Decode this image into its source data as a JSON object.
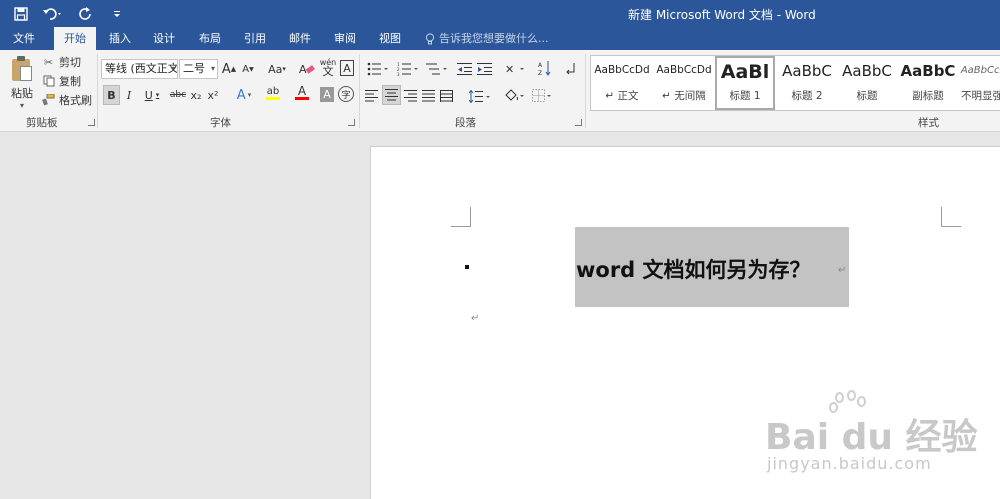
{
  "window": {
    "title": "新建 Microsoft Word 文档 - Word"
  },
  "quick_access": {
    "save_icon": "save-icon",
    "undo_icon": "undo-icon",
    "redo_icon": "redo-icon",
    "customize_icon": "customize-qat-icon"
  },
  "tabs": [
    {
      "label": "文件"
    },
    {
      "label": "开始"
    },
    {
      "label": "插入"
    },
    {
      "label": "设计"
    },
    {
      "label": "布局"
    },
    {
      "label": "引用"
    },
    {
      "label": "邮件"
    },
    {
      "label": "审阅"
    },
    {
      "label": "视图"
    }
  ],
  "active_tab": "开始",
  "tell_me": {
    "placeholder": "告诉我您想要做什么..."
  },
  "clipboard": {
    "paste": "粘贴",
    "cut": "剪切",
    "copy": "复制",
    "format_painter": "格式刷",
    "group_label": "剪贴板"
  },
  "font": {
    "font_name": "等线 (西文正文)",
    "font_size": "二号",
    "bold": "B",
    "italic": "I",
    "underline": "U",
    "strikethrough": "abc",
    "subscript": "x₂",
    "superscript": "x²",
    "grow": "A",
    "shrink": "A",
    "change_case": "Aa",
    "phonetic_top": "wén",
    "phonetic_bottom": "文",
    "char_border": "A",
    "text_effect": "A",
    "highlight": "ab",
    "font_color": "A",
    "char_shading": "A",
    "enclose": "字",
    "group_label": "字体"
  },
  "paragraph": {
    "group_label": "段落"
  },
  "styles": {
    "items": [
      {
        "preview": "AaBbCcDd",
        "name": "↵ 正文"
      },
      {
        "preview": "AaBbCcDd",
        "name": "↵ 无间隔"
      },
      {
        "preview": "AaBl",
        "name": "标题 1"
      },
      {
        "preview": "AaBbC",
        "name": "标题 2"
      },
      {
        "preview": "AaBbC",
        "name": "标题"
      },
      {
        "preview": "AaBbC",
        "name": "副标题"
      },
      {
        "preview": "AaBbCcD",
        "name": "不明显强"
      }
    ],
    "group_label": "样式"
  },
  "document": {
    "heading": "word 文档如何另为存？",
    "para_mark": "↵"
  },
  "watermark": {
    "main": "Bai du 经验",
    "sub": "jingyan.baidu.com"
  },
  "colors": {
    "accent": "#2b579a",
    "ribbon_bg": "#f3f3f3",
    "selection": "#c3c3c3",
    "highlight_yellow": "#ffff00",
    "font_red": "#ff0000"
  }
}
